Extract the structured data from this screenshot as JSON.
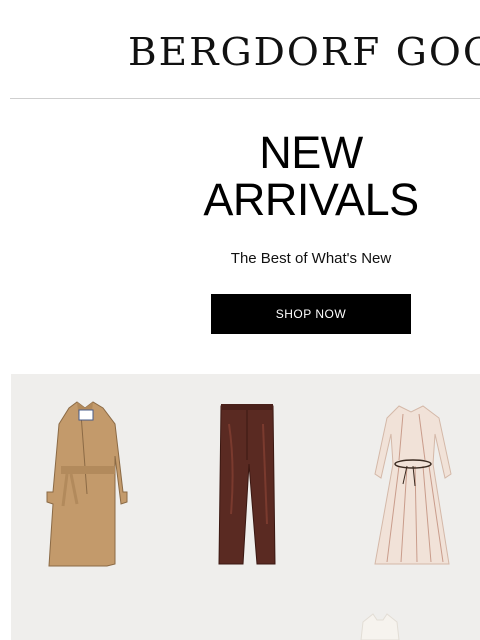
{
  "header": {
    "brand_logo": "BERGDORF GOODMAN"
  },
  "hero": {
    "title_line1": "NEW",
    "title_line2": "ARRIVALS",
    "subtitle": "The Best of What's New",
    "cta_label": "SHOP NOW"
  },
  "products": {
    "items": [
      {
        "name": "trench-coat",
        "color": "#c39a6b"
      },
      {
        "name": "leather-pants",
        "color": "#5a2a22"
      },
      {
        "name": "striped-dress",
        "color": "#f1e2d8"
      },
      {
        "name": "white-top",
        "color": "#f6f3ee"
      }
    ],
    "background_color": "#efeeec"
  },
  "colors": {
    "accent_button": "#000000",
    "button_text": "#ffffff"
  }
}
